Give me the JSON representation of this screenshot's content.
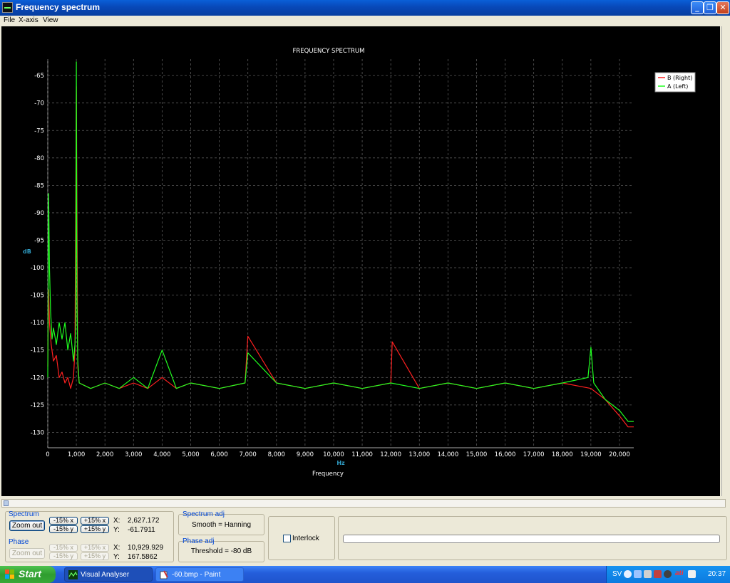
{
  "window": {
    "title": "Frequency spectrum"
  },
  "menu": [
    "File",
    "X-axis",
    "View"
  ],
  "chart_data": {
    "type": "line",
    "title": "FREQUENCY SPECTRUM",
    "xlabel": "Frequency",
    "xunit": "Hz",
    "ylabel": "dB",
    "xlim": [
      0,
      20500
    ],
    "ylim": [
      -132.8,
      -62
    ],
    "xticks": [
      0,
      1000,
      2000,
      3000,
      4000,
      5000,
      6000,
      7000,
      8000,
      9000,
      10000,
      11000,
      12000,
      13000,
      14000,
      15000,
      16000,
      17000,
      18000,
      19000,
      20000
    ],
    "xtick_labels": [
      "0",
      "1,000",
      "2,000",
      "3,000",
      "4,000",
      "5,000",
      "6,000",
      "7,000",
      "8,000",
      "9,000",
      "10,000",
      "11,000",
      "12,000",
      "13,000",
      "14,000",
      "15,000",
      "16,000",
      "17,000",
      "18,000",
      "19,000",
      "20,000"
    ],
    "yticks": [
      -65,
      -70,
      -75,
      -80,
      -85,
      -90,
      -95,
      -100,
      -105,
      -110,
      -115,
      -120,
      -125,
      -130
    ],
    "ytick_labels": [
      "-65",
      "-70",
      "-75",
      "-80",
      "-85",
      "-90",
      "-95",
      "-100",
      "-105",
      "-110",
      "-115",
      "-120",
      "-125",
      "-130"
    ],
    "grid": true,
    "legend_position": "top-right",
    "series": [
      {
        "name": "B (Right)",
        "color": "#ff2020",
        "x": [
          0,
          30,
          60,
          120,
          200,
          300,
          400,
          500,
          600,
          700,
          800,
          900,
          950,
          1000,
          1050,
          1100,
          1500,
          2000,
          2500,
          3000,
          3500,
          4000,
          4500,
          5000,
          6000,
          6900,
          7000,
          8000,
          9000,
          10000,
          11000,
          12000,
          12050,
          13000,
          14000,
          15000,
          16000,
          17000,
          18000,
          19000,
          19500,
          20000,
          20300,
          20500
        ],
        "y": [
          -118,
          -104,
          -110,
          -114,
          -117,
          -116,
          -120,
          -119,
          -121,
          -120,
          -122,
          -120,
          -115,
          -67,
          -118,
          -121,
          -122,
          -121,
          -122,
          -121,
          -122,
          -120,
          -122,
          -121,
          -122,
          -121,
          -112.5,
          -121,
          -122,
          -121,
          -122,
          -121,
          -113.5,
          -122,
          -121,
          -122,
          -121,
          -122,
          -121,
          -122,
          -124,
          -127,
          -129,
          -129
        ]
      },
      {
        "name": "A (Left)",
        "color": "#20ff20",
        "x": [
          0,
          30,
          60,
          100,
          150,
          200,
          300,
          400,
          500,
          600,
          700,
          800,
          900,
          950,
          980,
          1000,
          1020,
          1050,
          1100,
          1500,
          2000,
          2500,
          3000,
          3500,
          4000,
          4500,
          5000,
          6000,
          6900,
          7000,
          8000,
          9000,
          10000,
          11000,
          12000,
          13000,
          14000,
          15000,
          16000,
          17000,
          18000,
          18900,
          19000,
          19100,
          19500,
          20000,
          20300,
          20500
        ],
        "y": [
          -120,
          -86.5,
          -100,
          -108,
          -113,
          -111,
          -114,
          -110,
          -113,
          -110,
          -115,
          -112,
          -117,
          -114,
          -110,
          -62.5,
          -105,
          -117,
          -121,
          -122,
          -121,
          -122,
          -120,
          -122,
          -115,
          -122,
          -121,
          -122,
          -121,
          -115.5,
          -121,
          -122,
          -121,
          -122,
          -121,
          -122,
          -121,
          -122,
          -121,
          -122,
          -121,
          -120,
          -114.5,
          -121,
          -124,
          -126,
          -128,
          -128
        ]
      }
    ]
  },
  "spectrum": {
    "group_title": "Spectrum",
    "zoom_out": "Zoom out",
    "minus_x": "-15% x",
    "plus_x": "+15% x",
    "minus_y": "-15% y",
    "plus_y": "+15% y",
    "x_label": "X:",
    "x_value": "2,627.172",
    "y_label": "Y:",
    "y_value": "-61.7911"
  },
  "phase": {
    "group_title": "Phase",
    "zoom_out": "Zoom out",
    "minus_x": "-15% x",
    "plus_x": "+15% x",
    "minus_y": "-15% y",
    "plus_y": "+15% y",
    "x_label": "X:",
    "x_value": "10,929.929",
    "y_label": "Y:",
    "y_value": "167.5862"
  },
  "spectrum_adj": {
    "group_title": "Spectrum adj",
    "text": "Smooth = Hanning"
  },
  "phase_adj": {
    "group_title": "Phase adj",
    "text": "Threshold = -80 dB"
  },
  "interlock": {
    "label": "Interlock",
    "checked": false
  },
  "taskbar": {
    "start": "Start",
    "tasks": [
      "Visual Analyser",
      "-60.bmp - Paint"
    ],
    "lang": "SV",
    "tray_text": "ati",
    "clock": "20:37"
  }
}
